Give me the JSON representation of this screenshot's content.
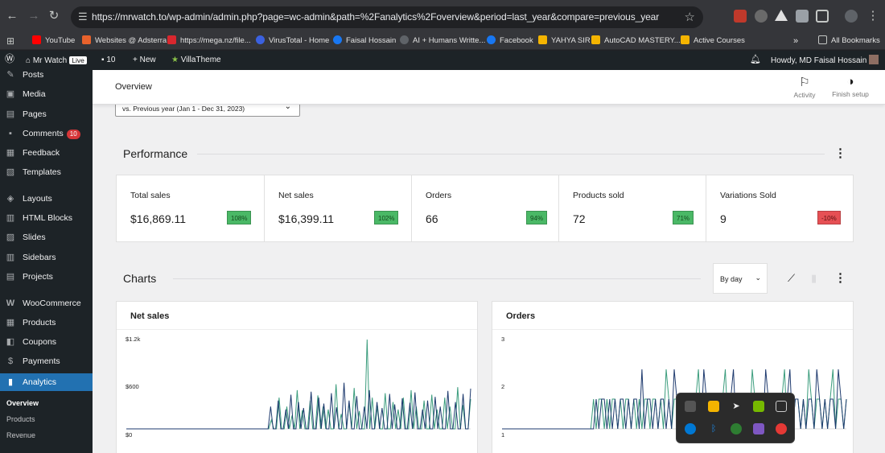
{
  "browser": {
    "url": "https://mrwatch.to/wp-admin/admin.php?page=wc-admin&path=%2Fanalytics%2Foverview&period=last_year&compare=previous_year",
    "bookmarks": [
      {
        "label": "YouTube",
        "color": "#ff0000"
      },
      {
        "label": "Websites @ Adsterra",
        "color": "#e8622c"
      },
      {
        "label": "https://mega.nz/file...",
        "color": "#d9272e"
      },
      {
        "label": "VirusTotal - Home",
        "color": "#3b61e0"
      },
      {
        "label": "Faisal Hossain",
        "color": "#1877f2"
      },
      {
        "label": "AI + Humans Writte...",
        "color": "#5f6368"
      },
      {
        "label": "Facebook",
        "color": "#1877f2"
      },
      {
        "label": "YAHYA SIR",
        "color": "#f4b400"
      },
      {
        "label": "AutoCAD MASTERY...",
        "color": "#f4b400"
      },
      {
        "label": "Active Courses",
        "color": "#f4b400"
      }
    ],
    "bookmarks_overflow": "»",
    "all_bookmarks": "All Bookmarks"
  },
  "adminbar": {
    "site_name": "Mr Watch",
    "live": "Live",
    "comments_count": "10",
    "new_label": "New",
    "theme_label": "VillaTheme",
    "howdy": "Howdy, MD Faisal Hossain"
  },
  "sidebar": {
    "items": [
      {
        "label": "Posts",
        "icon": "pin-icon"
      },
      {
        "label": "Media",
        "icon": "media-icon"
      },
      {
        "label": "Pages",
        "icon": "pages-icon"
      },
      {
        "label": "Comments",
        "icon": "comment-icon",
        "badge": "10"
      },
      {
        "label": "Feedback",
        "icon": "feedback-icon"
      },
      {
        "label": "Templates",
        "icon": "templates-icon"
      },
      {
        "label": "Layouts",
        "icon": "layouts-icon"
      },
      {
        "label": "HTML Blocks",
        "icon": "html-icon"
      },
      {
        "label": "Slides",
        "icon": "slides-icon"
      },
      {
        "label": "Sidebars",
        "icon": "sidebars-icon"
      },
      {
        "label": "Projects",
        "icon": "projects-icon"
      },
      {
        "label": "WooCommerce",
        "icon": "woo-icon"
      },
      {
        "label": "Products",
        "icon": "products-icon"
      },
      {
        "label": "Coupons",
        "icon": "coupons-icon"
      },
      {
        "label": "Payments",
        "icon": "payments-icon"
      },
      {
        "label": "Analytics",
        "icon": "analytics-icon",
        "active": true
      }
    ],
    "submenu": [
      "Overview",
      "Products",
      "Revenue"
    ]
  },
  "header": {
    "title": "Overview",
    "activity": "Activity",
    "finish_setup": "Finish setup"
  },
  "date_compare": "vs. Previous year (Jan 1 - Dec 31, 2023)",
  "performance": {
    "title": "Performance",
    "cards": [
      {
        "label": "Total sales",
        "value": "$16,869.11",
        "delta": "108%",
        "trend": "up"
      },
      {
        "label": "Net sales",
        "value": "$16,399.11",
        "delta": "102%",
        "trend": "up"
      },
      {
        "label": "Orders",
        "value": "66",
        "delta": "94%",
        "trend": "up"
      },
      {
        "label": "Products sold",
        "value": "72",
        "delta": "71%",
        "trend": "up"
      },
      {
        "label": "Variations Sold",
        "value": "9",
        "delta": "-10%",
        "trend": "down"
      }
    ]
  },
  "charts": {
    "title": "Charts",
    "interval": "By day"
  },
  "chart_data": [
    {
      "type": "line",
      "title": "Net sales",
      "y_ticks": [
        "$1.2k",
        "$600",
        "$0"
      ],
      "ylim": [
        0,
        1200
      ],
      "series": [
        {
          "color": "#3a9c7c",
          "values": [
            0,
            0,
            0,
            0,
            0,
            0,
            0,
            0,
            0,
            0,
            0,
            0,
            0,
            0,
            0,
            0,
            0,
            0,
            0,
            0,
            0,
            0,
            0,
            0,
            0,
            0,
            0,
            0,
            0,
            0,
            0,
            0,
            0,
            0,
            0,
            0,
            0,
            0,
            0,
            0,
            0,
            0,
            0,
            0,
            0,
            0,
            0,
            0,
            0,
            0,
            0,
            0,
            0,
            0,
            0,
            0,
            120,
            0,
            0,
            420,
            0,
            0,
            300,
            0,
            180,
            0,
            520,
            0,
            250,
            0,
            0,
            380,
            0,
            0,
            450,
            0,
            300,
            0,
            260,
            0,
            0,
            600,
            0,
            200,
            0,
            0,
            350,
            0,
            550,
            0,
            240,
            0,
            0,
            1200,
            0,
            420,
            0,
            310,
            0,
            0,
            480,
            0,
            0,
            360,
            0,
            260,
            0,
            420,
            0,
            0,
            520,
            0,
            300,
            0,
            0,
            380,
            0,
            0,
            460,
            0,
            260,
            0,
            0,
            420,
            0,
            300,
            0,
            0,
            560,
            0,
            320,
            0,
            0,
            400
          ]
        },
        {
          "color": "#1e3a6e",
          "values": [
            0,
            0,
            0,
            0,
            0,
            0,
            0,
            0,
            0,
            0,
            0,
            0,
            0,
            0,
            0,
            0,
            0,
            0,
            0,
            0,
            0,
            0,
            0,
            0,
            0,
            0,
            0,
            0,
            0,
            0,
            0,
            0,
            0,
            0,
            0,
            0,
            0,
            0,
            0,
            0,
            0,
            0,
            0,
            0,
            0,
            0,
            0,
            0,
            0,
            0,
            0,
            0,
            0,
            0,
            0,
            0,
            0,
            300,
            0,
            0,
            380,
            0,
            0,
            260,
            0,
            460,
            0,
            0,
            360,
            0,
            280,
            0,
            0,
            500,
            0,
            0,
            420,
            0,
            340,
            0,
            0,
            480,
            0,
            290,
            0,
            0,
            620,
            0,
            380,
            0,
            0,
            440,
            0,
            0,
            300,
            0,
            520,
            0,
            0,
            360,
            0,
            280,
            0,
            0,
            470,
            0,
            330,
            0,
            0,
            410,
            0,
            0,
            350,
            0,
            490,
            0,
            0,
            260,
            0,
            380,
            0,
            0,
            430,
            0,
            300,
            0,
            0,
            510,
            0,
            0,
            360,
            0,
            0,
            470,
            0,
            0,
            540
          ]
        }
      ]
    },
    {
      "type": "line",
      "title": "Orders",
      "y_ticks": [
        "3",
        "2",
        "1"
      ],
      "ylim": [
        0,
        3
      ],
      "series": [
        {
          "color": "#3a9c7c",
          "values": [
            0,
            0,
            0,
            0,
            0,
            0,
            0,
            0,
            0,
            0,
            0,
            0,
            0,
            0,
            0,
            0,
            0,
            0,
            0,
            0,
            0,
            0,
            0,
            0,
            0,
            0,
            0,
            0,
            0,
            0,
            0,
            0,
            0,
            0,
            1,
            0,
            1,
            1,
            0,
            1,
            0,
            1,
            1,
            0,
            1,
            0,
            1,
            1,
            0,
            1,
            0,
            1,
            0,
            1,
            1,
            0,
            1,
            1,
            0,
            1,
            0,
            2,
            1,
            0,
            1,
            1,
            0,
            1,
            0,
            1,
            1,
            0,
            1,
            2,
            0,
            1,
            0,
            1,
            1,
            0,
            1,
            0,
            1,
            2,
            0,
            1,
            1,
            0,
            1,
            0,
            1,
            1,
            0,
            2,
            1,
            0,
            1,
            1,
            0,
            1,
            0,
            1,
            1,
            0,
            1,
            2,
            0,
            1,
            0,
            1,
            1,
            0,
            1,
            0,
            2,
            1,
            0,
            1,
            1,
            0,
            1,
            0,
            1,
            2,
            0,
            1,
            1,
            0,
            1
          ]
        },
        {
          "color": "#1e3a6e",
          "values": [
            0,
            0,
            0,
            0,
            0,
            0,
            0,
            0,
            0,
            0,
            0,
            0,
            0,
            0,
            0,
            0,
            0,
            0,
            0,
            0,
            0,
            0,
            0,
            0,
            0,
            0,
            0,
            0,
            0,
            0,
            0,
            0,
            0,
            0,
            0,
            1,
            0,
            1,
            1,
            0,
            1,
            0,
            1,
            0,
            1,
            1,
            0,
            1,
            0,
            1,
            1,
            0,
            2,
            0,
            1,
            1,
            0,
            1,
            0,
            1,
            1,
            0,
            1,
            0,
            2,
            1,
            0,
            1,
            1,
            0,
            1,
            0,
            1,
            1,
            0,
            2,
            1,
            0,
            1,
            0,
            1,
            1,
            0,
            1,
            0,
            1,
            2,
            0,
            1,
            1,
            0,
            1,
            0,
            1,
            1,
            0,
            1,
            0,
            2,
            1,
            0,
            1,
            0,
            1,
            1,
            0,
            1,
            2,
            0,
            1,
            1,
            0,
            1,
            0,
            1,
            1,
            0,
            2,
            1,
            0,
            1,
            0,
            1,
            1,
            0,
            2,
            1,
            0,
            1
          ]
        }
      ]
    }
  ]
}
